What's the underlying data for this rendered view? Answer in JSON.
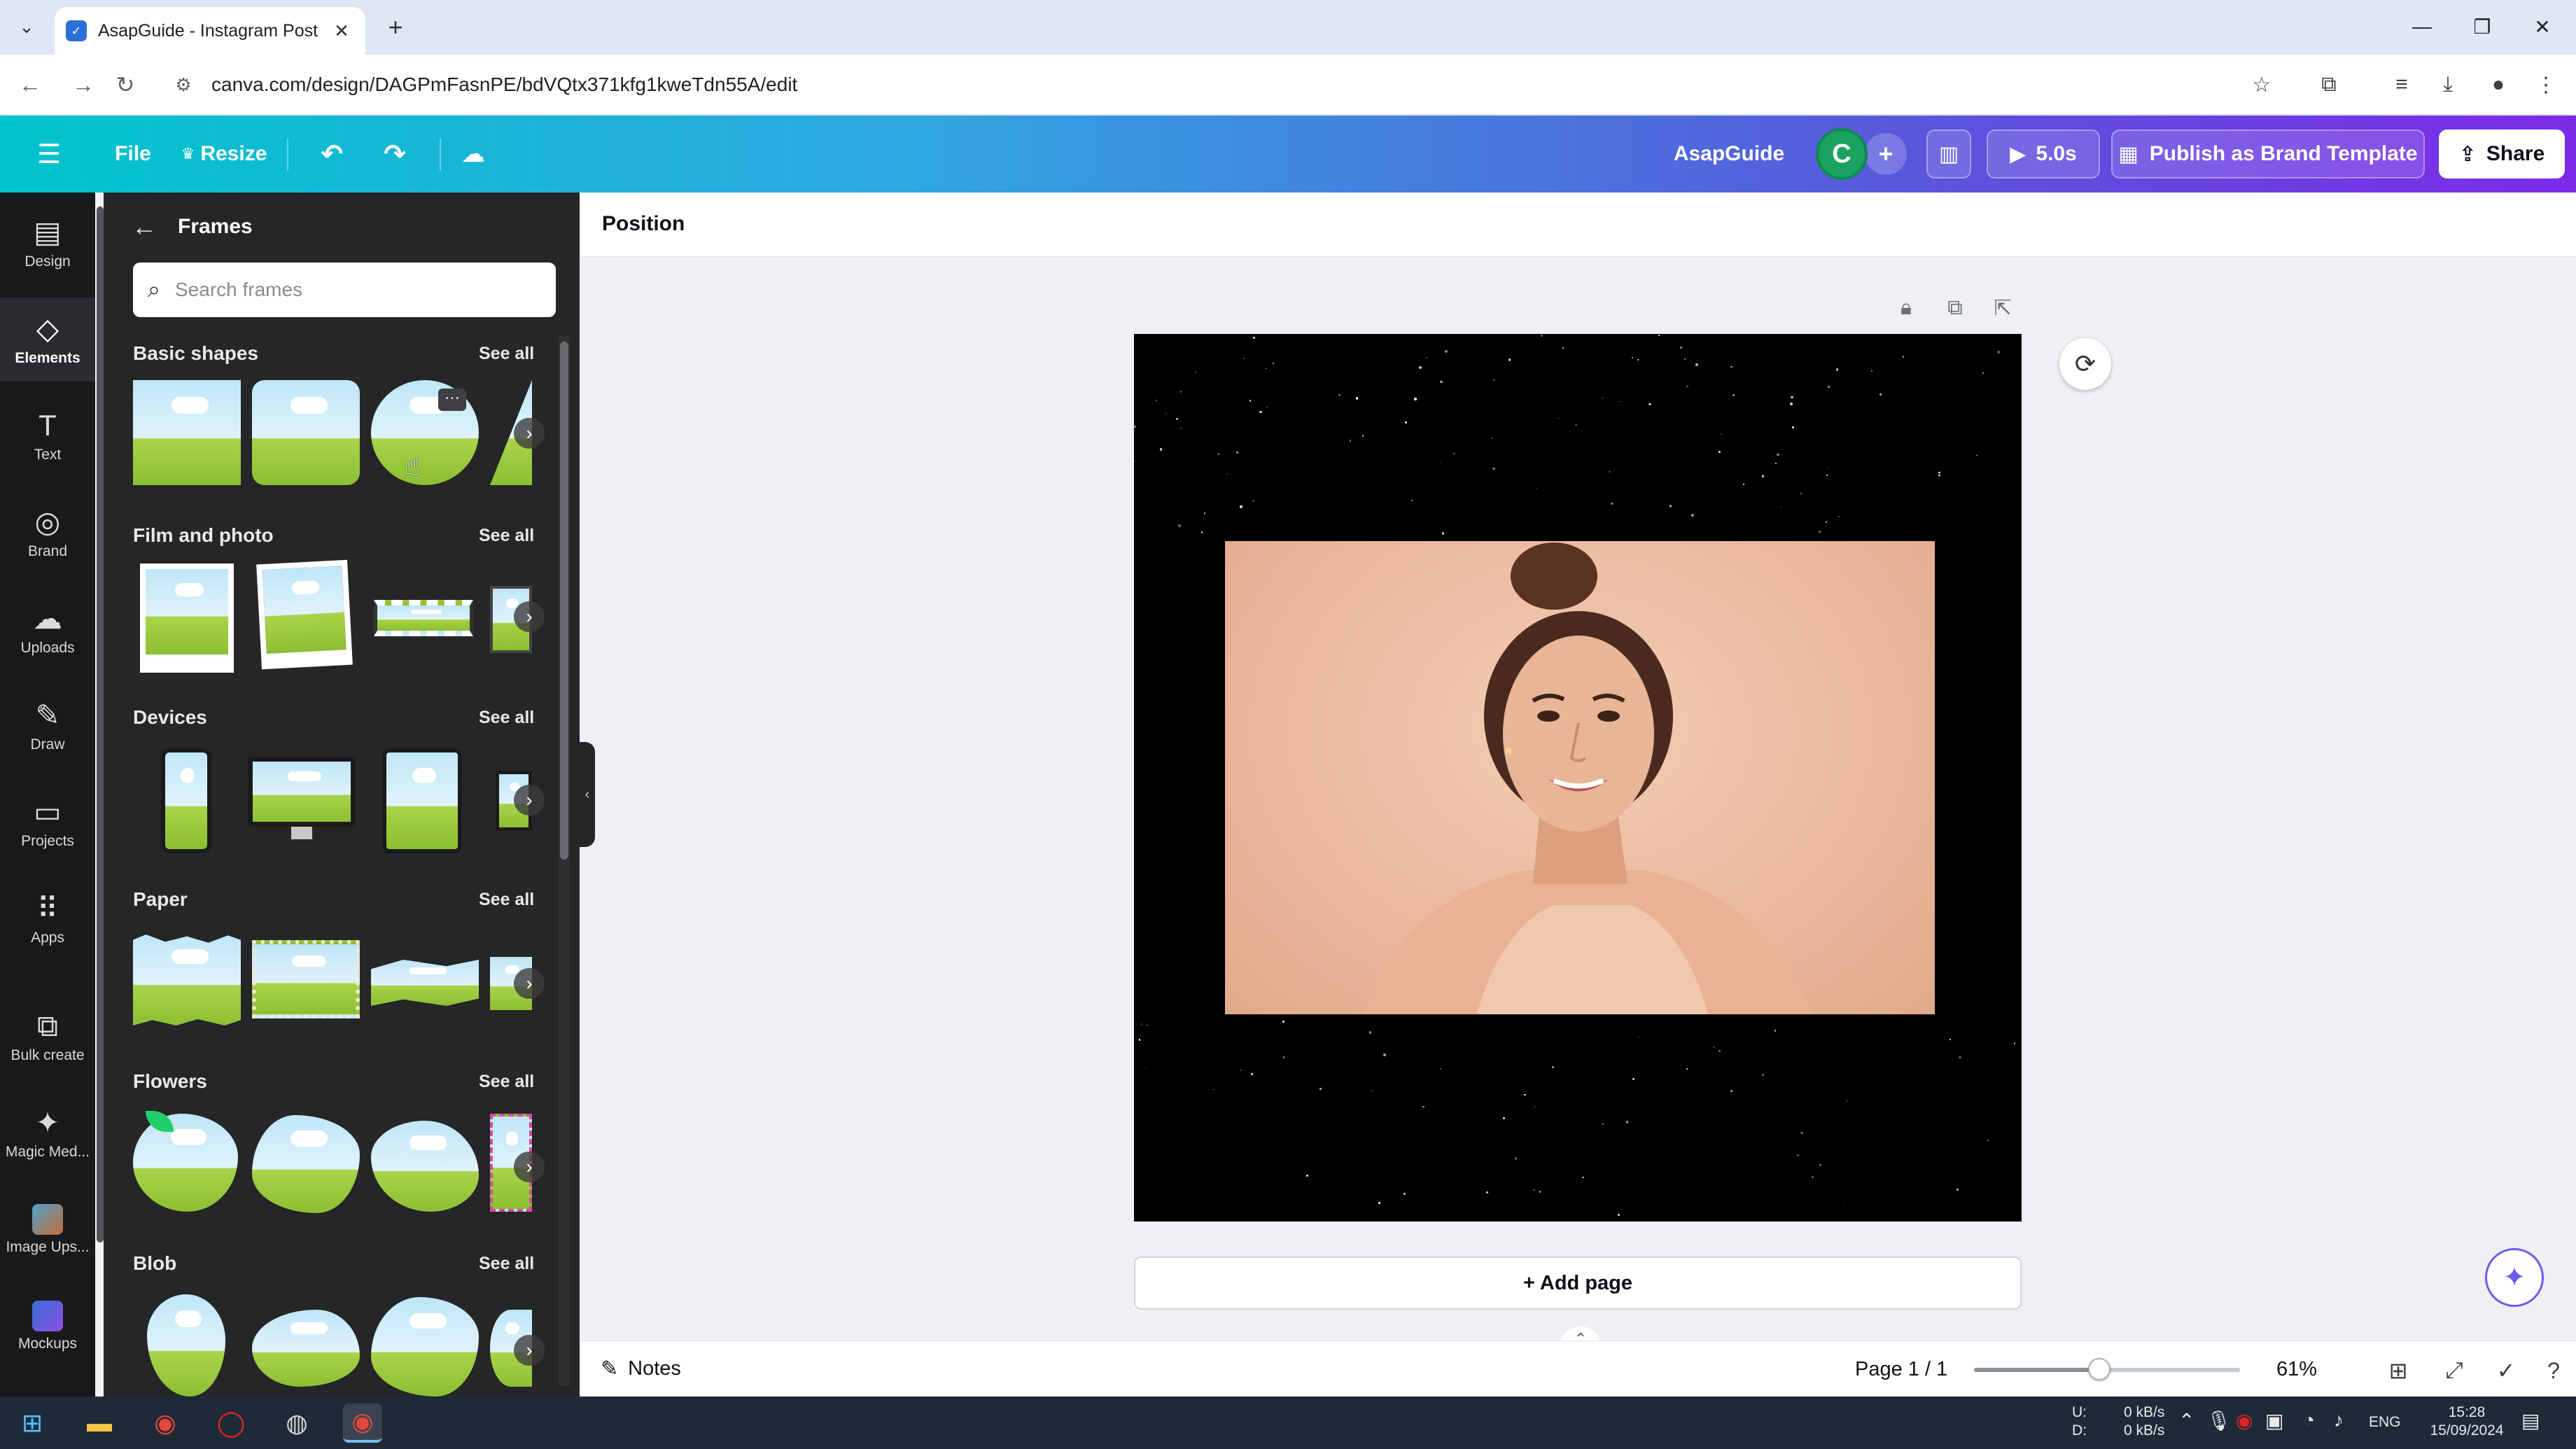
{
  "browser": {
    "tab_title": "AsapGuide - Instagram Post",
    "url": "canva.com/design/DAGPmFasnPE/bdVQtx371kfg1kweTdn55A/edit"
  },
  "header": {
    "file_label": "File",
    "resize_label": "Resize",
    "team_name": "AsapGuide",
    "avatar_initial": "C",
    "play_duration": "5.0s",
    "publish_label": "Publish as Brand Template",
    "share_label": "Share"
  },
  "rail": {
    "items": [
      {
        "label": "Design",
        "icon": "design-icon"
      },
      {
        "label": "Elements",
        "icon": "elements-icon"
      },
      {
        "label": "Text",
        "icon": "text-icon"
      },
      {
        "label": "Brand",
        "icon": "brand-icon"
      },
      {
        "label": "Uploads",
        "icon": "uploads-icon"
      },
      {
        "label": "Draw",
        "icon": "draw-icon"
      },
      {
        "label": "Projects",
        "icon": "projects-icon"
      },
      {
        "label": "Apps",
        "icon": "apps-icon"
      },
      {
        "label": "Bulk create",
        "icon": "bulk-create-icon"
      },
      {
        "label": "Magic Med...",
        "icon": "magic-media-icon"
      },
      {
        "label": "Image Ups...",
        "icon": "image-upscaler-icon"
      },
      {
        "label": "Mockups",
        "icon": "mockups-icon"
      }
    ],
    "active": "Elements"
  },
  "panel": {
    "title": "Frames",
    "search_placeholder": "Search frames",
    "see_all_label": "See all",
    "sections": [
      {
        "title": "Basic shapes"
      },
      {
        "title": "Film and photo"
      },
      {
        "title": "Devices"
      },
      {
        "title": "Paper"
      },
      {
        "title": "Flowers"
      },
      {
        "title": "Blob"
      }
    ]
  },
  "editor": {
    "context_label": "Position",
    "add_page_label": "+ Add page",
    "notes_label": "Notes",
    "page_indicator": "Page 1 / 1",
    "zoom_level": "61%",
    "zoom_fraction": 0.47
  },
  "taskbar": {
    "net_up_label": "U:",
    "net_down_label": "D:",
    "net_up": "0 kB/s",
    "net_down": "0 kB/s",
    "lang": "ENG",
    "time": "15:28",
    "date": "15/09/2024"
  },
  "colors": {
    "header_gradient_start": "#00c4cc",
    "header_gradient_end": "#7d2ae8",
    "rail_bg": "#18191b",
    "panel_bg": "#252627",
    "avatar_bg": "#1aa260"
  }
}
